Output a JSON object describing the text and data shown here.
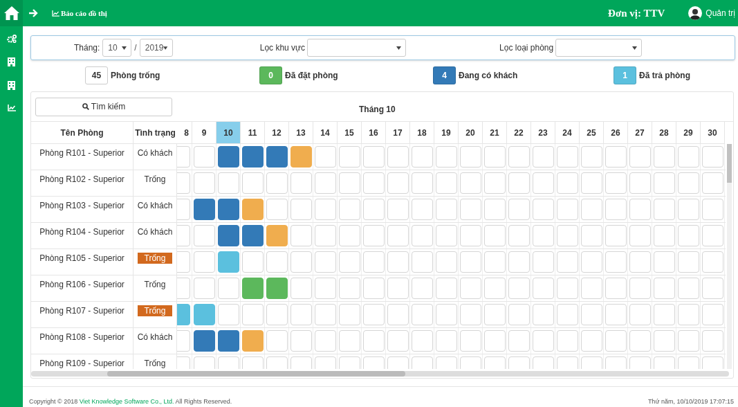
{
  "topbar": {
    "page_title": "Báo cáo đồ thị",
    "unit": "Đơn vị: TTV",
    "user": "Quản trị"
  },
  "filters": {
    "month_label": "Tháng:",
    "month": "10",
    "separator": "/",
    "year": "2019",
    "area_label": "Lọc khu vực",
    "room_type_label": "Lọc loại phòng"
  },
  "legend": [
    {
      "count": "45",
      "label": "Phòng trống",
      "color": "#ffffff"
    },
    {
      "count": "0",
      "label": "Đã đặt phòng",
      "color": "#5cb85c"
    },
    {
      "count": "4",
      "label": "Đang có khách",
      "color": "#337ab7"
    },
    {
      "count": "1",
      "label": "Đã trả phòng",
      "color": "#5bc0de"
    }
  ],
  "search_button": "Tìm kiếm",
  "calendar_title": "Tháng 10",
  "columns": [
    "Tên Phòng",
    "Tình trạng"
  ],
  "days": [
    {
      "label": "8",
      "selected": false
    },
    {
      "label": "9",
      "selected": false
    },
    {
      "label": "10",
      "selected": true
    },
    {
      "label": "11",
      "selected": false
    },
    {
      "label": "12",
      "selected": false
    },
    {
      "label": "13",
      "selected": false
    },
    {
      "label": "14",
      "selected": false
    },
    {
      "label": "15",
      "selected": false
    },
    {
      "label": "16",
      "selected": false
    },
    {
      "label": "17",
      "selected": false
    },
    {
      "label": "18",
      "selected": false
    },
    {
      "label": "19",
      "selected": false
    },
    {
      "label": "20",
      "selected": false
    },
    {
      "label": "21",
      "selected": false
    },
    {
      "label": "22",
      "selected": false
    },
    {
      "label": "23",
      "selected": false
    },
    {
      "label": "24",
      "selected": false
    },
    {
      "label": "25",
      "selected": false
    },
    {
      "label": "26",
      "selected": false
    },
    {
      "label": "27",
      "selected": false
    },
    {
      "label": "28",
      "selected": false
    },
    {
      "label": "29",
      "selected": false
    },
    {
      "label": "30",
      "selected": false
    }
  ],
  "rooms": [
    {
      "name": "Phòng R101 - Superior",
      "status": "Có khách",
      "status_highlight": false,
      "cells": [
        {
          "kind": "empty"
        },
        {
          "kind": "empty"
        },
        {
          "kind": "filled",
          "color": "#337ab7"
        },
        {
          "kind": "filled",
          "color": "#337ab7"
        },
        {
          "kind": "filled",
          "color": "#337ab7"
        },
        {
          "kind": "filled",
          "color": "#f0ad4e"
        },
        {
          "kind": "empty"
        },
        {
          "kind": "empty"
        },
        {
          "kind": "empty"
        },
        {
          "kind": "empty"
        },
        {
          "kind": "empty"
        },
        {
          "kind": "empty"
        },
        {
          "kind": "empty"
        },
        {
          "kind": "empty"
        },
        {
          "kind": "empty"
        },
        {
          "kind": "empty"
        },
        {
          "kind": "empty"
        },
        {
          "kind": "empty"
        },
        {
          "kind": "empty"
        },
        {
          "kind": "empty"
        },
        {
          "kind": "empty"
        },
        {
          "kind": "empty"
        },
        {
          "kind": "empty"
        }
      ]
    },
    {
      "name": "Phòng R102 - Superior",
      "status": "Trống",
      "status_highlight": false,
      "cells": [
        {
          "kind": "empty"
        },
        {
          "kind": "empty"
        },
        {
          "kind": "empty"
        },
        {
          "kind": "empty"
        },
        {
          "kind": "empty"
        },
        {
          "kind": "empty"
        },
        {
          "kind": "empty"
        },
        {
          "kind": "empty"
        },
        {
          "kind": "empty"
        },
        {
          "kind": "empty"
        },
        {
          "kind": "empty"
        },
        {
          "kind": "empty"
        },
        {
          "kind": "empty"
        },
        {
          "kind": "empty"
        },
        {
          "kind": "empty"
        },
        {
          "kind": "empty"
        },
        {
          "kind": "empty"
        },
        {
          "kind": "empty"
        },
        {
          "kind": "empty"
        },
        {
          "kind": "empty"
        },
        {
          "kind": "empty"
        },
        {
          "kind": "empty"
        },
        {
          "kind": "empty"
        }
      ]
    },
    {
      "name": "Phòng R103 - Superior",
      "status": "Có khách",
      "status_highlight": false,
      "cells": [
        {
          "kind": "empty"
        },
        {
          "kind": "filled",
          "color": "#337ab7"
        },
        {
          "kind": "filled",
          "color": "#337ab7"
        },
        {
          "kind": "filled",
          "color": "#f0ad4e"
        },
        {
          "kind": "empty"
        },
        {
          "kind": "empty"
        },
        {
          "kind": "empty"
        },
        {
          "kind": "empty"
        },
        {
          "kind": "empty"
        },
        {
          "kind": "empty"
        },
        {
          "kind": "empty"
        },
        {
          "kind": "empty"
        },
        {
          "kind": "empty"
        },
        {
          "kind": "empty"
        },
        {
          "kind": "empty"
        },
        {
          "kind": "empty"
        },
        {
          "kind": "empty"
        },
        {
          "kind": "empty"
        },
        {
          "kind": "empty"
        },
        {
          "kind": "empty"
        },
        {
          "kind": "empty"
        },
        {
          "kind": "empty"
        },
        {
          "kind": "empty"
        }
      ]
    },
    {
      "name": "Phòng R104 - Superior",
      "status": "Có khách",
      "status_highlight": false,
      "cells": [
        {
          "kind": "empty"
        },
        {
          "kind": "empty"
        },
        {
          "kind": "filled",
          "color": "#337ab7"
        },
        {
          "kind": "filled",
          "color": "#337ab7"
        },
        {
          "kind": "filled",
          "color": "#f0ad4e"
        },
        {
          "kind": "empty"
        },
        {
          "kind": "empty"
        },
        {
          "kind": "empty"
        },
        {
          "kind": "empty"
        },
        {
          "kind": "empty"
        },
        {
          "kind": "empty"
        },
        {
          "kind": "empty"
        },
        {
          "kind": "empty"
        },
        {
          "kind": "empty"
        },
        {
          "kind": "empty"
        },
        {
          "kind": "empty"
        },
        {
          "kind": "empty"
        },
        {
          "kind": "empty"
        },
        {
          "kind": "empty"
        },
        {
          "kind": "empty"
        },
        {
          "kind": "empty"
        },
        {
          "kind": "empty"
        },
        {
          "kind": "empty"
        }
      ]
    },
    {
      "name": "Phòng R105 - Superior",
      "status": "Trống",
      "status_highlight": true,
      "cells": [
        {
          "kind": "empty"
        },
        {
          "kind": "empty"
        },
        {
          "kind": "filled",
          "color": "#5bc0de"
        },
        {
          "kind": "empty"
        },
        {
          "kind": "empty"
        },
        {
          "kind": "empty"
        },
        {
          "kind": "empty"
        },
        {
          "kind": "empty"
        },
        {
          "kind": "empty"
        },
        {
          "kind": "empty"
        },
        {
          "kind": "empty"
        },
        {
          "kind": "empty"
        },
        {
          "kind": "empty"
        },
        {
          "kind": "empty"
        },
        {
          "kind": "empty"
        },
        {
          "kind": "empty"
        },
        {
          "kind": "empty"
        },
        {
          "kind": "empty"
        },
        {
          "kind": "empty"
        },
        {
          "kind": "empty"
        },
        {
          "kind": "empty"
        },
        {
          "kind": "empty"
        },
        {
          "kind": "empty"
        }
      ]
    },
    {
      "name": "Phòng R106 - Superior",
      "status": "Trống",
      "status_highlight": false,
      "cells": [
        {
          "kind": "empty"
        },
        {
          "kind": "empty"
        },
        {
          "kind": "empty"
        },
        {
          "kind": "filled",
          "color": "#5cb85c"
        },
        {
          "kind": "filled",
          "color": "#5cb85c"
        },
        {
          "kind": "empty"
        },
        {
          "kind": "empty"
        },
        {
          "kind": "empty"
        },
        {
          "kind": "empty"
        },
        {
          "kind": "empty"
        },
        {
          "kind": "empty"
        },
        {
          "kind": "empty"
        },
        {
          "kind": "empty"
        },
        {
          "kind": "empty"
        },
        {
          "kind": "empty"
        },
        {
          "kind": "empty"
        },
        {
          "kind": "empty"
        },
        {
          "kind": "empty"
        },
        {
          "kind": "empty"
        },
        {
          "kind": "empty"
        },
        {
          "kind": "empty"
        },
        {
          "kind": "empty"
        },
        {
          "kind": "empty"
        }
      ]
    },
    {
      "name": "Phòng R107 - Superior",
      "status": "Trống",
      "status_highlight": true,
      "cells": [
        {
          "kind": "filled",
          "color": "#5bc0de"
        },
        {
          "kind": "filled",
          "color": "#5bc0de"
        },
        {
          "kind": "empty"
        },
        {
          "kind": "empty"
        },
        {
          "kind": "empty"
        },
        {
          "kind": "empty"
        },
        {
          "kind": "empty"
        },
        {
          "kind": "empty"
        },
        {
          "kind": "empty"
        },
        {
          "kind": "empty"
        },
        {
          "kind": "empty"
        },
        {
          "kind": "empty"
        },
        {
          "kind": "empty"
        },
        {
          "kind": "empty"
        },
        {
          "kind": "empty"
        },
        {
          "kind": "empty"
        },
        {
          "kind": "empty"
        },
        {
          "kind": "empty"
        },
        {
          "kind": "empty"
        },
        {
          "kind": "empty"
        },
        {
          "kind": "empty"
        },
        {
          "kind": "empty"
        },
        {
          "kind": "empty"
        }
      ]
    },
    {
      "name": "Phòng R108 - Superior",
      "status": "Có khách",
      "status_highlight": false,
      "cells": [
        {
          "kind": "empty"
        },
        {
          "kind": "filled",
          "color": "#337ab7"
        },
        {
          "kind": "filled",
          "color": "#337ab7"
        },
        {
          "kind": "filled",
          "color": "#f0ad4e"
        },
        {
          "kind": "empty"
        },
        {
          "kind": "empty"
        },
        {
          "kind": "empty"
        },
        {
          "kind": "empty"
        },
        {
          "kind": "empty"
        },
        {
          "kind": "empty"
        },
        {
          "kind": "empty"
        },
        {
          "kind": "empty"
        },
        {
          "kind": "empty"
        },
        {
          "kind": "empty"
        },
        {
          "kind": "empty"
        },
        {
          "kind": "empty"
        },
        {
          "kind": "empty"
        },
        {
          "kind": "empty"
        },
        {
          "kind": "empty"
        },
        {
          "kind": "empty"
        },
        {
          "kind": "empty"
        },
        {
          "kind": "empty"
        },
        {
          "kind": "empty"
        }
      ]
    },
    {
      "name": "Phòng R109 - Superior",
      "status": "Trống",
      "status_highlight": false,
      "cells": [
        {
          "kind": "empty"
        },
        {
          "kind": "empty"
        },
        {
          "kind": "empty"
        },
        {
          "kind": "empty"
        },
        {
          "kind": "empty"
        },
        {
          "kind": "empty"
        },
        {
          "kind": "empty"
        },
        {
          "kind": "empty"
        },
        {
          "kind": "empty"
        },
        {
          "kind": "empty"
        },
        {
          "kind": "empty"
        },
        {
          "kind": "empty"
        },
        {
          "kind": "empty"
        },
        {
          "kind": "empty"
        },
        {
          "kind": "empty"
        },
        {
          "kind": "empty"
        },
        {
          "kind": "empty"
        },
        {
          "kind": "empty"
        },
        {
          "kind": "empty"
        },
        {
          "kind": "empty"
        },
        {
          "kind": "empty"
        },
        {
          "kind": "empty"
        },
        {
          "kind": "empty"
        }
      ]
    }
  ],
  "footer": {
    "copyright_before": "Copyright © 2018 ",
    "company_link": "Viet Knowledge Software Co., Ltd.",
    "copyright_after": " All Rights Reserved.",
    "datetime": "Thứ năm, 10/10/2019 17:07:15"
  }
}
